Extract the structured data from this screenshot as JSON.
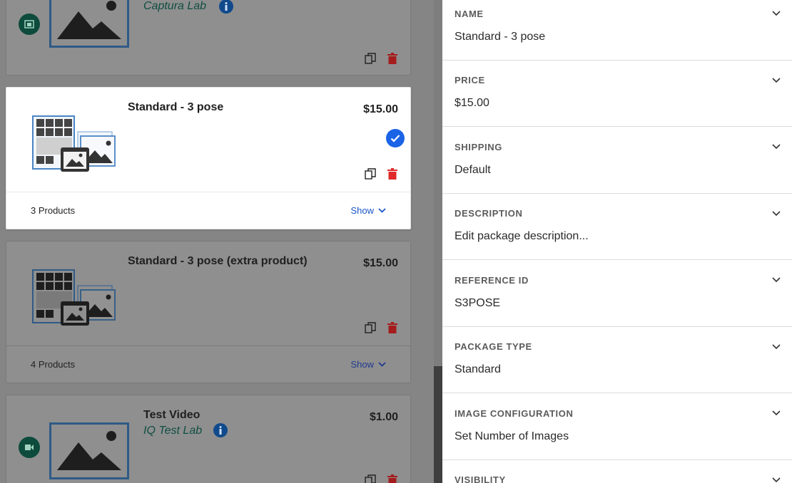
{
  "packages": [
    {
      "title": "",
      "lab": "Captura Lab",
      "price": "",
      "icon": "lab-badge-icon",
      "thumbnail": "image-placeholder-icon",
      "selected": false
    },
    {
      "title": "Standard - 3 pose",
      "lab": "",
      "price": "$15.00",
      "thumbnail": "package-collage-icon",
      "selected": true,
      "product_count": "3 Products",
      "show_label": "Show"
    },
    {
      "title": "Standard - 3 pose (extra product)",
      "lab": "",
      "price": "$15.00",
      "thumbnail": "package-collage-icon",
      "selected": false,
      "product_count": "4 Products",
      "show_label": "Show"
    },
    {
      "title": "Test Video",
      "lab": "IQ Test Lab",
      "price": "$1.00",
      "icon": "video-badge-icon",
      "thumbnail": "image-placeholder-icon",
      "selected": false
    }
  ],
  "details": {
    "name": {
      "label": "NAME",
      "value": "Standard - 3 pose"
    },
    "price": {
      "label": "PRICE",
      "value": "$15.00"
    },
    "shipping": {
      "label": "SHIPPING",
      "value": "Default"
    },
    "description": {
      "label": "DESCRIPTION",
      "value": "Edit package description..."
    },
    "reference_id": {
      "label": "REFERENCE ID",
      "value": "S3POSE"
    },
    "package_type": {
      "label": "PACKAGE TYPE",
      "value": "Standard"
    },
    "image_configuration": {
      "label": "IMAGE CONFIGURATION",
      "value": "Set Number of Images"
    },
    "visibility": {
      "label": "VISIBILITY",
      "value": ""
    }
  },
  "colors": {
    "accent": "#1a63e6",
    "delete": "#d92a2a",
    "lab_text": "#0f4e41",
    "badge": "#0d4b3c",
    "thumbnail_border": "#4a84c4"
  }
}
